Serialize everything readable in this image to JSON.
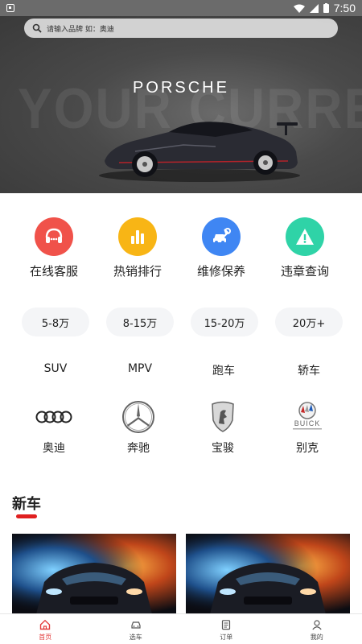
{
  "status_bar": {
    "time": "7:50"
  },
  "search": {
    "placeholder": "请输入品牌  如：奥迪"
  },
  "banner": {
    "brand": "PORSCHE",
    "background_text": "YOUR CURRENT VEHICLE",
    "slides": 3,
    "active_slide": 3
  },
  "features": [
    {
      "label": "在线客服",
      "icon": "headset-icon",
      "color": "#f0524a"
    },
    {
      "label": "热销排行",
      "icon": "bar-chart-icon",
      "color": "#f8b515"
    },
    {
      "label": "维修保养",
      "icon": "wrench-car-icon",
      "color": "#3f86f3"
    },
    {
      "label": "违章查询",
      "icon": "warning-icon",
      "color": "#2fd3a7"
    }
  ],
  "price_ranges": [
    "5-8万",
    "8-15万",
    "15-20万",
    "20万+"
  ],
  "car_types": [
    "SUV",
    "MPV",
    "跑车",
    "轿车"
  ],
  "brands": [
    {
      "label": "奥迪",
      "icon": "audi-logo-icon"
    },
    {
      "label": "奔驰",
      "icon": "mercedes-logo-icon"
    },
    {
      "label": "宝骏",
      "icon": "baojun-logo-icon"
    },
    {
      "label": "别克",
      "icon": "buick-logo-icon",
      "logo_text": "BUICK"
    }
  ],
  "new_cars": {
    "title": "新车"
  },
  "bottom_nav": [
    {
      "label": "首页",
      "icon": "home-icon",
      "active": true
    },
    {
      "label": "选车",
      "icon": "car-icon",
      "active": false
    },
    {
      "label": "订单",
      "icon": "order-icon",
      "active": false
    },
    {
      "label": "我的",
      "icon": "user-icon",
      "active": false
    }
  ],
  "colors": {
    "accent": "#e02020",
    "chip_bg": "#f4f5f7"
  }
}
